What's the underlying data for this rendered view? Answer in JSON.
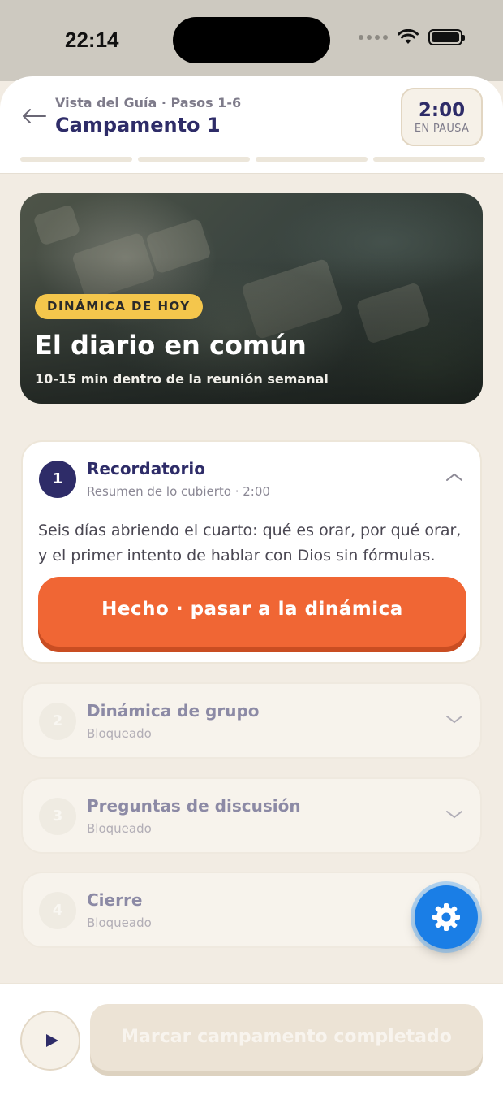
{
  "status_bar": {
    "time": "22:14"
  },
  "header": {
    "subtitle": "Vista del Guía · Pasos 1-6",
    "title": "Campamento 1",
    "timer_value": "2:00",
    "timer_label": "EN PAUSA"
  },
  "hero": {
    "badge": "DINÁMICA DE HOY",
    "title": "El diario en común",
    "subtitle": "10-15 min dentro de la reunión semanal"
  },
  "steps": [
    {
      "number": "1",
      "title": "Recordatorio",
      "subtitle": "Resumen de lo cubierto · 2:00",
      "body": "Seis días abriendo el cuarto: qué es orar, por qué orar, y el primer intento de hablar con Dios sin fórmulas.",
      "action": "Hecho · pasar a la dinámica",
      "expanded": true
    },
    {
      "number": "2",
      "title": "Dinámica de grupo",
      "subtitle": "Bloqueado"
    },
    {
      "number": "3",
      "title": "Preguntas de discusión",
      "subtitle": "Bloqueado"
    },
    {
      "number": "4",
      "title": "Cierre",
      "subtitle": "Bloqueado"
    }
  ],
  "bottom": {
    "complete_label": "Marcar campamento completado"
  },
  "icons": {
    "back": "arrow-left-icon",
    "expand": "chevron-up-icon",
    "collapse": "chevron-down-icon",
    "settings": "gear-icon",
    "play": "play-icon"
  },
  "colors": {
    "accent": "#f06634",
    "primary": "#2e2c68",
    "badge": "#f4c64c",
    "fab": "#1a7ee6"
  }
}
